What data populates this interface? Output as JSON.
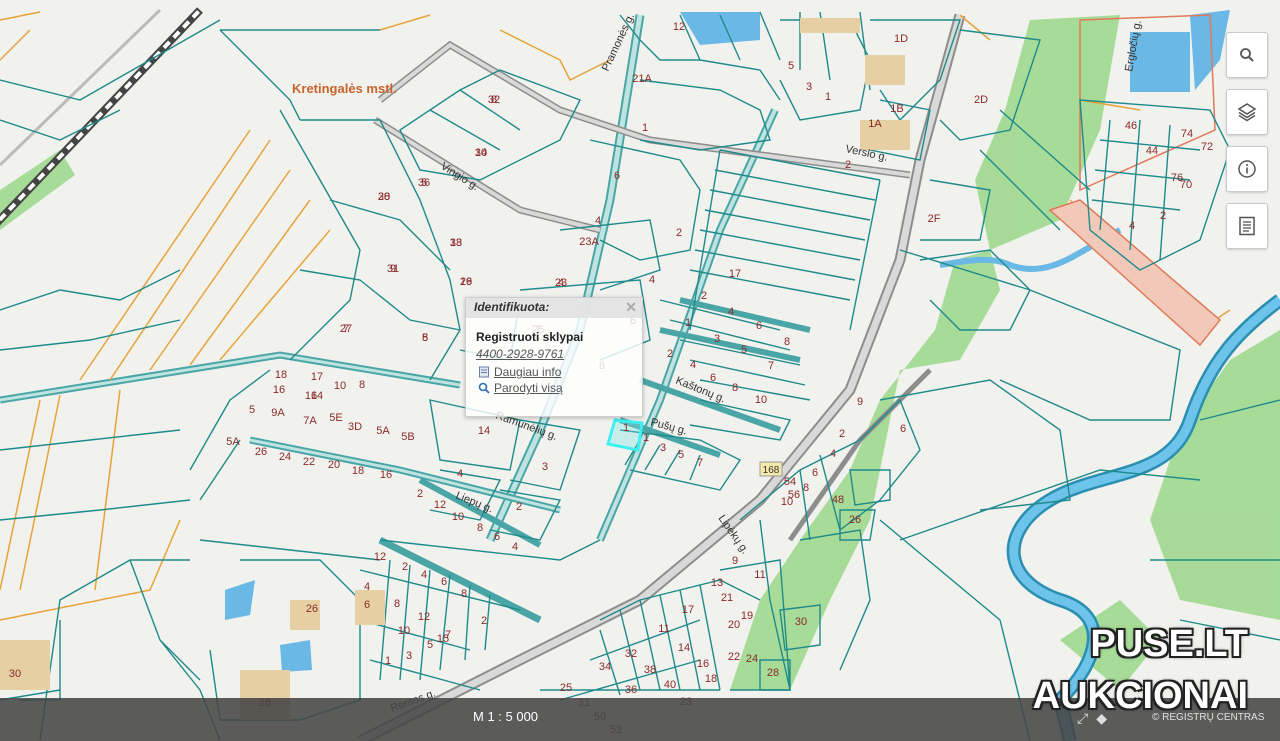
{
  "map": {
    "place_name": "Kretingalės mstl.",
    "streets": [
      "Vingio g.",
      "Verslo g.",
      "Liepų g.",
      "Kaštonų g.",
      "Pušų g.",
      "Ramunėlių g.",
      "Lipėkų g.",
      "Pramonės g.",
      "Rentos g.",
      "Ergločių g."
    ],
    "road_number": "168",
    "parcel_labels": [
      "8",
      "10",
      "5",
      "20",
      "18",
      "9",
      "16",
      "7",
      "5",
      "23",
      "25",
      "6",
      "8",
      "6",
      "4",
      "23A",
      "2",
      "4",
      "12",
      "21A",
      "1",
      "5",
      "3",
      "1",
      "1D",
      "1B",
      "1A",
      "2",
      "2D",
      "2F",
      "17",
      "2",
      "4",
      "6",
      "8",
      "1",
      "3",
      "5",
      "7",
      "2",
      "4",
      "6",
      "8",
      "10",
      "18",
      "17",
      "14",
      "10",
      "8",
      "16",
      "16",
      "5",
      "9A",
      "7A",
      "5E",
      "3D",
      "5A",
      "5B",
      "5A",
      "26",
      "24",
      "22",
      "20",
      "18",
      "16",
      "14",
      "4",
      "3",
      "2",
      "12",
      "10",
      "8",
      "6",
      "4",
      "2",
      "1",
      "1",
      "3",
      "5",
      "7",
      "9",
      "2",
      "4",
      "6",
      "8",
      "10",
      "12",
      "2",
      "4",
      "6",
      "8",
      "2",
      "4",
      "6",
      "8",
      "10",
      "12",
      "15",
      "1",
      "3",
      "5",
      "7",
      "9",
      "11",
      "13",
      "21",
      "19",
      "17",
      "11",
      "14",
      "16",
      "18",
      "20",
      "22",
      "24",
      "26",
      "28",
      "30",
      "32",
      "34",
      "36",
      "38",
      "40",
      "23",
      "25",
      "31",
      "50",
      "52",
      "54",
      "56",
      "48",
      "46",
      "44",
      "76",
      "74",
      "72",
      "70",
      "2",
      "4",
      "6",
      "26",
      "28",
      "30",
      "32",
      "34",
      "36",
      "38",
      "33",
      "31",
      "29",
      "27",
      "8",
      "4",
      "7",
      "5"
    ],
    "background_color": "#f1f1ee",
    "parcel_line_color": "#1f8a8a",
    "boundary_color": "#e8a33a",
    "green_color": "#9fd88e",
    "water_color": "#6ab8e6"
  },
  "toolbar": {
    "icons": [
      "search-icon",
      "layers-icon",
      "info-icon",
      "legend-icon"
    ]
  },
  "popup": {
    "title": "Identifikuota:",
    "layer": "Registruoti sklypai",
    "parcel_id": "4400-2928-9761",
    "more_info": "Daugiau info",
    "show_all": "Parodyti visą"
  },
  "bottom_bar": {
    "scale": "M 1 : 5 000",
    "copyright": "© REGISTRŲ CENTRAS"
  },
  "watermark": {
    "line1": "PUSE.LT",
    "line2": "AUKCIONAI"
  }
}
